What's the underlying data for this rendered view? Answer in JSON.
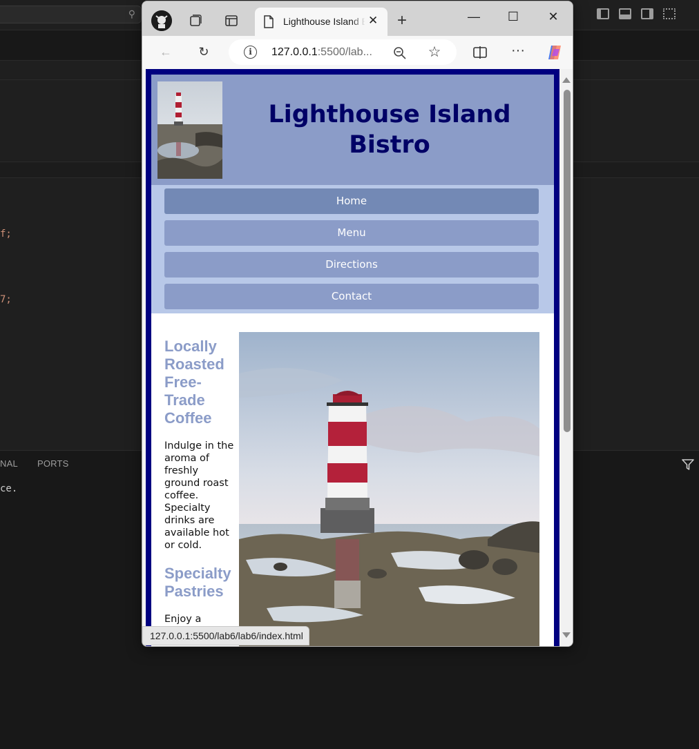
{
  "browser": {
    "tab_title": "Lighthouse Island Bistro",
    "url_host": "127.0.0.1",
    "url_rest": ":5500/lab...",
    "status_url": "127.0.0.1:5500/lab6/lab6/index.html"
  },
  "site": {
    "title_line1": "Lighthouse Island",
    "title_line2": "Bistro",
    "nav": [
      "Home",
      "Menu",
      "Directions",
      "Contact"
    ],
    "sections": [
      {
        "heading_lines": [
          "Locally",
          "Roasted",
          "Free-",
          "Trade",
          "Coffee"
        ],
        "text_lines": [
          "Indulge in the",
          "aroma of",
          "freshly",
          "ground roast",
          "coffee.",
          "Specialty",
          "drinks are",
          "available hot",
          "or cold."
        ]
      },
      {
        "heading_lines": [
          "Specialty",
          "Pastries"
        ],
        "text_lines": [
          "Enjoy a"
        ]
      }
    ]
  },
  "editor": {
    "code_line1_text": "f;",
    "code_line2_text": "7;",
    "panel_tab1": "NAL",
    "panel_tab2": "PORTS",
    "panel_text": "ce."
  },
  "icons": {
    "back": "back-arrow-icon",
    "reload": "reload-icon",
    "zoom": "zoom-out-icon",
    "favorite": "star-icon",
    "split": "split-screen-icon",
    "more": "more-icon",
    "copilot": "copilot-icon"
  }
}
